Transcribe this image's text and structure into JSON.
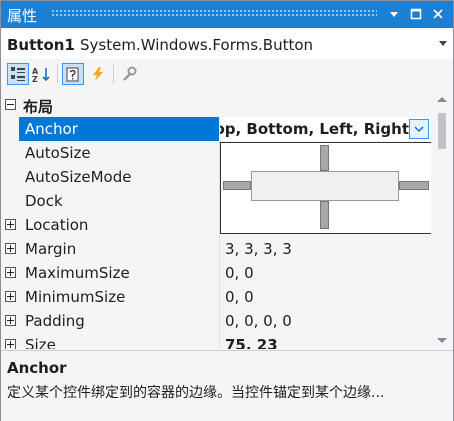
{
  "window": {
    "title": "属性"
  },
  "object_selector": {
    "name": "Button1",
    "type": "System.Windows.Forms.Button"
  },
  "toolbar": {
    "icons": [
      "categorized-icon",
      "alphabetical-icon",
      "properties-icon",
      "events-icon",
      "property-pages-icon"
    ]
  },
  "grid": {
    "category": "布局",
    "rows": [
      {
        "name": "Anchor",
        "value": "Top, Bottom, Left, Right"
      },
      {
        "name": "AutoSize",
        "value": ""
      },
      {
        "name": "AutoSizeMode",
        "value": ""
      },
      {
        "name": "Dock",
        "value": ""
      },
      {
        "name": "Location",
        "value": ""
      },
      {
        "name": "Margin",
        "value": "3, 3, 3, 3"
      },
      {
        "name": "MaximumSize",
        "value": "0, 0"
      },
      {
        "name": "MinimumSize",
        "value": "0, 0"
      },
      {
        "name": "Padding",
        "value": "0, 0, 0, 0"
      },
      {
        "name": "Size",
        "value": "75, 23"
      }
    ]
  },
  "description": {
    "title": "Anchor",
    "text": "定义某个控件绑定到的容器的边缘。当控件锚定到某个边缘..."
  },
  "colors": {
    "accent": "#1b7fd3",
    "selection": "#0078d7",
    "events_icon": "#f5a623"
  }
}
